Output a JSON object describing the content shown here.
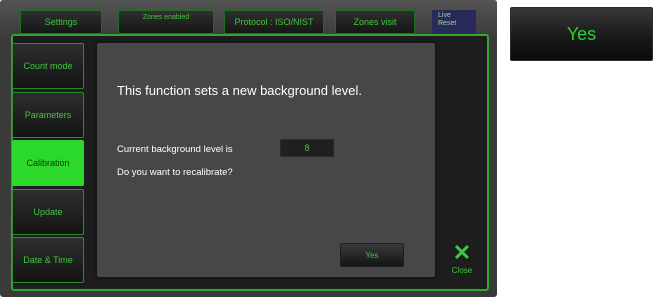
{
  "top_bar": {
    "tabs": [
      {
        "label": "Settings"
      },
      {
        "label": "Zones enabled"
      },
      {
        "label": "Protocol : ISO/NIST"
      },
      {
        "label": "Zones visit"
      },
      {
        "label": "Live\nReset"
      }
    ]
  },
  "sidebar": {
    "items": [
      {
        "label": "Count mode",
        "active": false
      },
      {
        "label": "Parameters",
        "active": false
      },
      {
        "label": "Calibration",
        "active": true
      },
      {
        "label": "Update",
        "active": false
      },
      {
        "label": "Date & Time",
        "active": false
      }
    ]
  },
  "dialog": {
    "title": "This function sets a new background level.",
    "level_label": "Current background level is",
    "level_value": "8",
    "question": "Do you want to recalibrate?",
    "yes_label": "Yes"
  },
  "close": {
    "icon": "close-x-icon",
    "label": "Close"
  },
  "zoom_yes_button": {
    "label": "Yes"
  },
  "colors": {
    "accent_green": "#2bd92b",
    "text_green": "#3ec83e",
    "dialog_bg": "#474747",
    "frame_green": "#2fa82f"
  }
}
